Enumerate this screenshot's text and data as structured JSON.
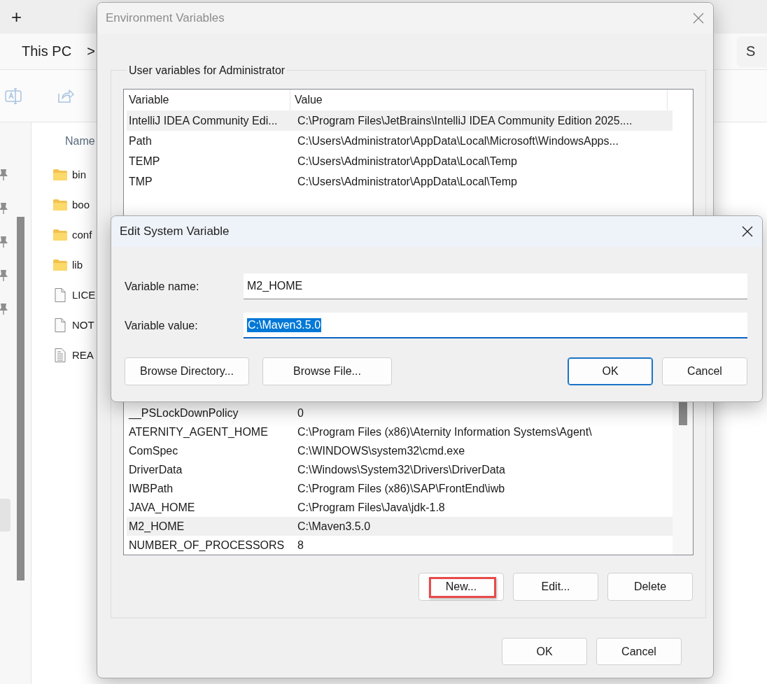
{
  "explorer": {
    "new_tab": "+",
    "breadcrumb": [
      {
        "label": "This PC"
      }
    ],
    "breadcrumb_separator": ">",
    "search_placeholder": "S",
    "file_list": {
      "column": "Name",
      "items": [
        {
          "name": "bin",
          "kind": "folder"
        },
        {
          "name": "boo",
          "kind": "folder"
        },
        {
          "name": "conf",
          "kind": "folder"
        },
        {
          "name": "lib",
          "kind": "folder"
        },
        {
          "name": "LICE",
          "kind": "file"
        },
        {
          "name": "NOT",
          "kind": "file"
        },
        {
          "name": "REA",
          "kind": "text_file"
        }
      ]
    }
  },
  "environment_dialog": {
    "title": "Environment Variables",
    "active": false,
    "user_variables": {
      "title": "User variables for Administrator",
      "columns": [
        "Variable",
        "Value"
      ],
      "rows": [
        {
          "variable": "IntelliJ IDEA Community Edi...",
          "value": "C:\\Program Files\\JetBrains\\IntelliJ IDEA Community Edition 2025....",
          "selected": true
        },
        {
          "variable": "Path",
          "value": "C:\\Users\\Administrator\\AppData\\Local\\Microsoft\\WindowsApps...",
          "selected": false
        },
        {
          "variable": "TEMP",
          "value": "C:\\Users\\Administrator\\AppData\\Local\\Temp",
          "selected": false
        },
        {
          "variable": "TMP",
          "value": "C:\\Users\\Administrator\\AppData\\Local\\Temp",
          "selected": false
        }
      ]
    },
    "system_variables": {
      "rows": [
        {
          "variable": "__PSLockDownPolicy",
          "value": "0",
          "selected": false
        },
        {
          "variable": "ATERNITY_AGENT_HOME",
          "value": "C:\\Program Files (x86)\\Aternity Information Systems\\Agent\\",
          "selected": false
        },
        {
          "variable": "ComSpec",
          "value": "C:\\WINDOWS\\system32\\cmd.exe",
          "selected": false
        },
        {
          "variable": "DriverData",
          "value": "C:\\Windows\\System32\\Drivers\\DriverData",
          "selected": false
        },
        {
          "variable": "IWBPath",
          "value": "C:\\Program Files (x86)\\SAP\\FrontEnd\\iwb",
          "selected": false
        },
        {
          "variable": "JAVA_HOME",
          "value": "C:\\Program Files\\Java\\jdk-1.8",
          "selected": false
        },
        {
          "variable": "M2_HOME",
          "value": "C:\\Maven3.5.0",
          "selected": true
        },
        {
          "variable": "NUMBER_OF_PROCESSORS",
          "value": "8",
          "selected": false
        }
      ],
      "buttons": [
        {
          "label": "New...",
          "highlighted": true
        },
        {
          "label": "Edit...",
          "highlighted": false
        },
        {
          "label": "Delete",
          "highlighted": false
        }
      ]
    },
    "buttons": [
      {
        "label": "OK"
      },
      {
        "label": "Cancel"
      }
    ]
  },
  "edit_dialog": {
    "title": "Edit System Variable",
    "fields": [
      {
        "label": "Variable name:",
        "value": "M2_HOME",
        "focused": false,
        "text_selected": false
      },
      {
        "label": "Variable value:",
        "value": "C:\\Maven3.5.0",
        "focused": true,
        "text_selected": true
      }
    ],
    "browse_buttons": [
      {
        "label": "Browse Directory..."
      },
      {
        "label": "Browse File..."
      }
    ],
    "buttons": [
      {
        "label": "OK",
        "default": true
      },
      {
        "label": "Cancel",
        "default": false
      }
    ]
  }
}
